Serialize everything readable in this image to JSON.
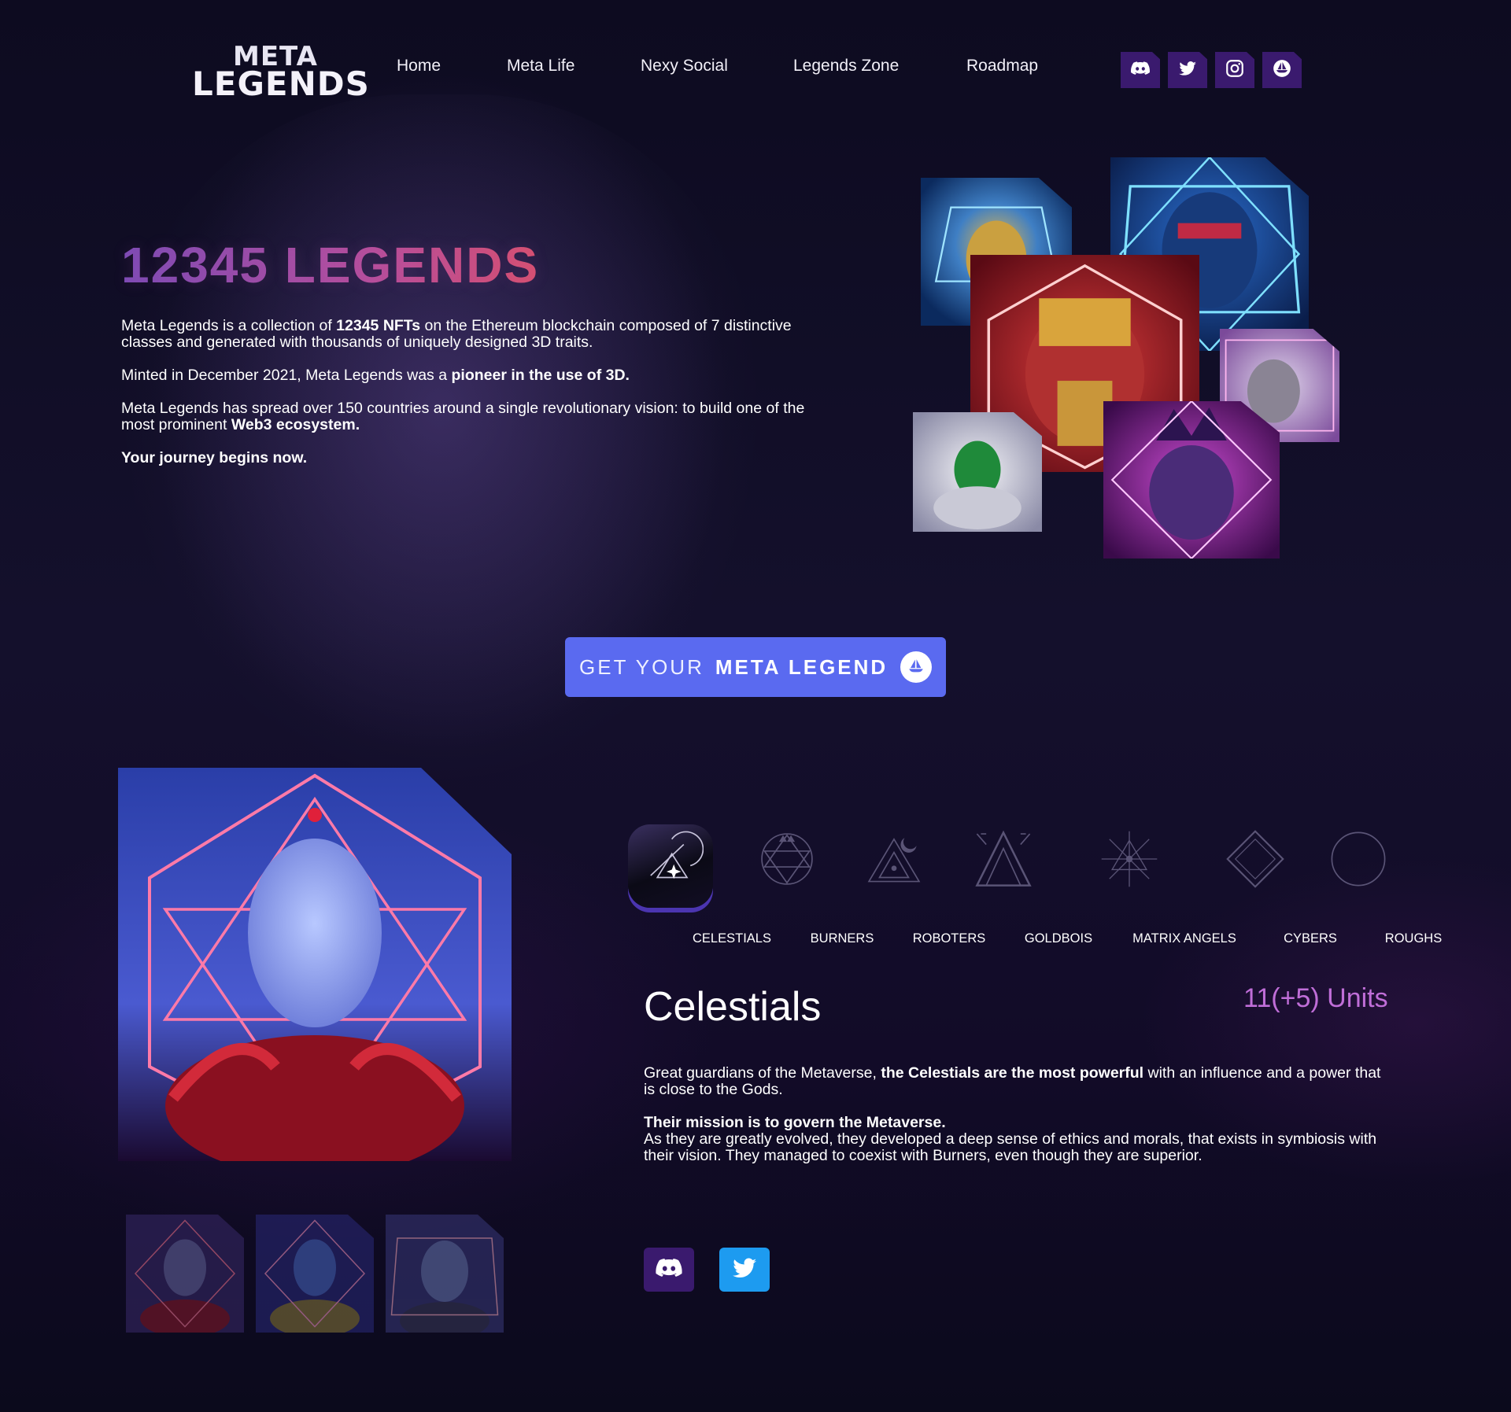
{
  "brand": {
    "logo_line1": "META",
    "logo_line2": "LEGENDS"
  },
  "nav": {
    "items": [
      {
        "label": "Home"
      },
      {
        "label": "Meta Life"
      },
      {
        "label": "Nexy Social"
      },
      {
        "label": "Legends Zone"
      },
      {
        "label": "Roadmap"
      }
    ],
    "socials": [
      "discord-icon",
      "twitter-icon",
      "instagram-icon",
      "opensea-icon"
    ]
  },
  "hero": {
    "title": "12345 LEGENDS",
    "p1_a": "Meta Legends is a collection of ",
    "p1_b": "12345 NFTs",
    "p1_c": " on the Ethereum blockchain composed of 7 distinctive classes and generated with thousands of uniquely designed 3D traits.",
    "p2_a": "Minted in December 2021, Meta Legends was a ",
    "p2_b": "pioneer in the use of 3D.",
    "p3_a": "Meta Legends has spread over 150 countries around a single revolutionary vision: to build one of the most prominent ",
    "p3_b": "Web3 ecosystem.",
    "p4": "Your journey begins now."
  },
  "cta": {
    "label_light": "GET YOUR",
    "label_bold": "META LEGEND",
    "icon": "opensea-icon"
  },
  "classes": {
    "items": [
      {
        "label": "CELESTIALS",
        "active": true
      },
      {
        "label": "BURNERS"
      },
      {
        "label": "ROBOTERS"
      },
      {
        "label": "GOLDBOIS"
      },
      {
        "label": "MATRIX ANGELS"
      },
      {
        "label": "CYBERS"
      },
      {
        "label": "ROUGHS"
      }
    ],
    "selected": {
      "name": "Celestials",
      "units": "11(+5) Units",
      "d1_a": "Great guardians of the Metaverse, ",
      "d1_b": "the Celestials are the most powerful",
      "d1_c": " with an influence and a power that is close to the Gods.",
      "d2_b": "Their mission is to govern the Metaverse.",
      "d2_c": "As they are greatly evolved, they developed a deep sense of ethics and morals, that exists in symbiosis with their vision. They managed to coexist with Burners, even though they are superior.",
      "socials": [
        "discord-icon",
        "twitter-icon"
      ]
    }
  },
  "colors": {
    "background": "#0c0a1e",
    "accent": "#5a6af0",
    "social_bg": "#3a1a6e",
    "units": "#c06ed8",
    "twitter": "#1d9bf0"
  }
}
